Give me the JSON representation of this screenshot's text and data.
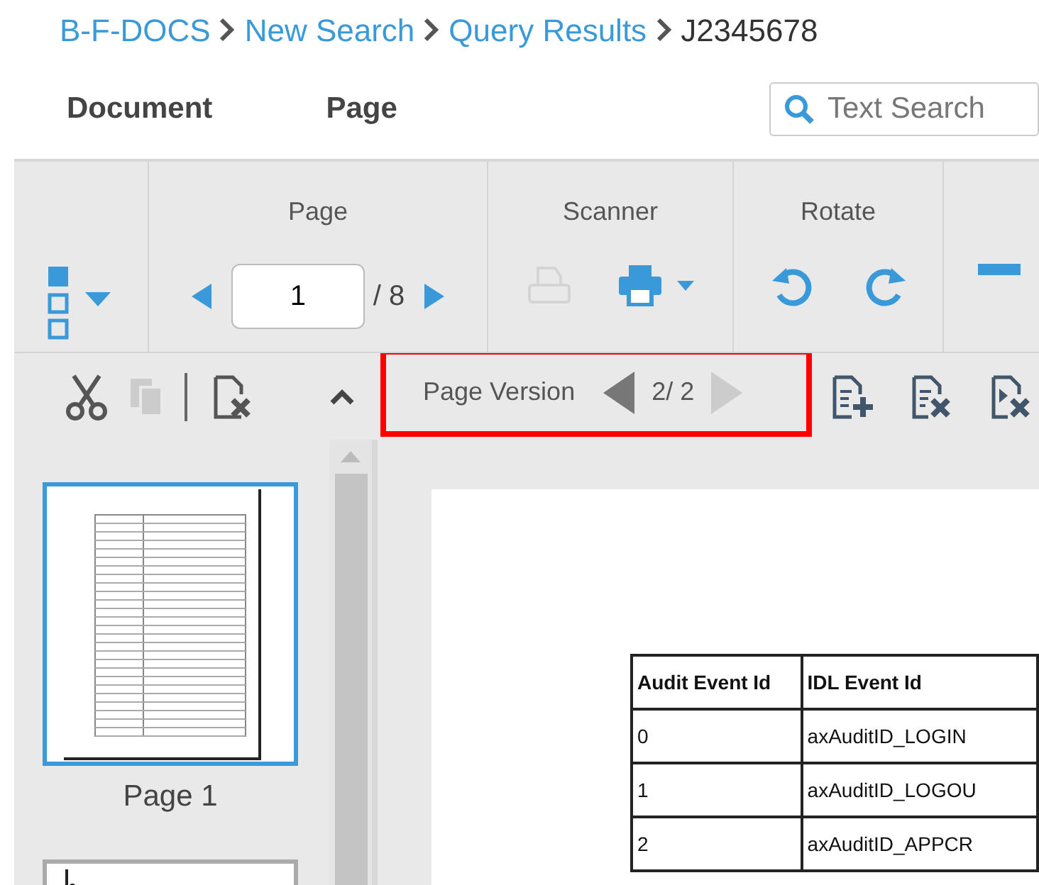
{
  "breadcrumb": [
    {
      "label": "B-F-DOCS",
      "link": true
    },
    {
      "label": "New Search",
      "link": true
    },
    {
      "label": "Query Results",
      "link": true
    },
    {
      "label": "J2345678",
      "link": false
    }
  ],
  "menu": [
    {
      "label": "Document"
    },
    {
      "label": "Page"
    }
  ],
  "search": {
    "placeholder": "Text Search"
  },
  "toolbar": {
    "groups": [
      {
        "kind": "layout"
      },
      {
        "kind": "pager",
        "label": "Page",
        "page": "1",
        "total": "/ 8"
      },
      {
        "kind": "scanner",
        "label": "Scanner",
        "scan_disabled": true
      },
      {
        "kind": "rotate",
        "label": "Rotate"
      },
      {
        "kind": "zoom"
      }
    ]
  },
  "page_tools": {
    "paste_disabled": true
  },
  "page_version": {
    "label": "Page Version",
    "value": "2/ 2",
    "highlighted": true,
    "prev_disabled": false,
    "next_disabled": true
  },
  "thumbnails": [
    {
      "label": "Page 1",
      "selected": true
    },
    {
      "selected": false
    }
  ],
  "document_table": {
    "columns": [
      "Audit Event Id",
      "IDL Event Id"
    ],
    "rows": [
      [
        "0",
        "axAuditID_LOGIN"
      ],
      [
        "1",
        "axAuditID_LOGOU"
      ],
      [
        "2",
        "axAuditID_APPCR"
      ]
    ]
  }
}
